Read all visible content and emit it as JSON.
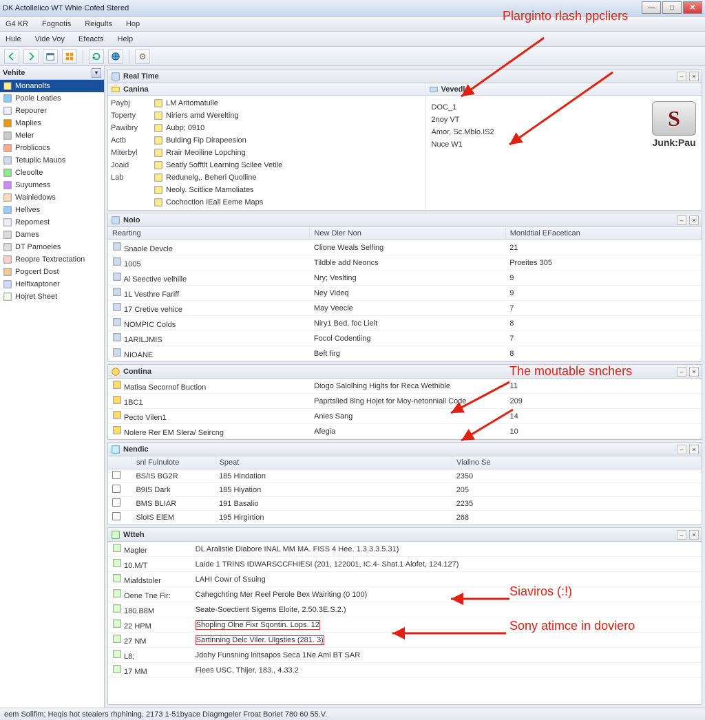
{
  "window": {
    "title": "DK Actollelico WT Whie Cofed Stered"
  },
  "menus_top": [
    "G4 KR",
    "Fognotis",
    "Reigults",
    "Hop"
  ],
  "menus": [
    "Hule",
    "Vide Voy",
    "Efeacts",
    "Help"
  ],
  "sidebar": {
    "header": "Vehite",
    "items": [
      {
        "label": "Monanolts",
        "sel": true,
        "icon": "folder"
      },
      {
        "label": "Poole Leaties",
        "icon": "globe"
      },
      {
        "label": "Repourer",
        "icon": "doc"
      },
      {
        "label": "Maplies",
        "icon": "grid"
      },
      {
        "label": "Meler",
        "icon": "meter"
      },
      {
        "label": "Problicocs",
        "icon": "wrench"
      },
      {
        "label": "Tetuplic Mauos",
        "icon": "phone"
      },
      {
        "label": "Cleoolte",
        "icon": "check"
      },
      {
        "label": "Suyumess",
        "icon": "chart"
      },
      {
        "label": "Wainledows",
        "icon": "cards"
      },
      {
        "label": "Hellves",
        "icon": "help"
      },
      {
        "label": "Repomest",
        "icon": "doc"
      },
      {
        "label": "Dames",
        "icon": "disk"
      },
      {
        "label": "DT Pamoeies",
        "icon": "disk"
      },
      {
        "label": "Reopre Textrectation",
        "icon": "gear"
      },
      {
        "label": "Pogcert Dost",
        "icon": "box"
      },
      {
        "label": "Helfixaptoner",
        "icon": "wand"
      },
      {
        "label": "Hojret Sheet",
        "icon": "sheet"
      }
    ]
  },
  "realtime": {
    "title": "Real Time"
  },
  "canina": {
    "title": "Canina",
    "rows": [
      {
        "k": "Paybj",
        "v": "LM Aritomatulle"
      },
      {
        "k": "Toperty",
        "v": "Niriers amd Werelting"
      },
      {
        "k": "Pawibry",
        "v": "Aubp; 0910"
      },
      {
        "k": "Actb",
        "v": "Bulding Fip Dirapeesion"
      },
      {
        "k": "Miterbyl",
        "v": "Rrair Meoiline Lopching"
      },
      {
        "k": "Joaid",
        "v": "Seatly 5offtlt Learning Scilee Vetile"
      },
      {
        "k": "Lab",
        "v": "Redunelg,. Beheri Quolline"
      },
      {
        "k": "",
        "v": "Neoly. Scitlice Mamoliates"
      },
      {
        "k": "",
        "v": "Cochoction IEall Eeme Maps"
      }
    ]
  },
  "vehicle": {
    "title": "Vevedle",
    "items": [
      "DOC_1",
      "2noy VT",
      "Amor, Sc.Mblo.IS2",
      "Nuce W1"
    ],
    "brand": "Junk:Pau"
  },
  "nolo": {
    "title": "Nolo",
    "cols": [
      "Rearting",
      "New Dier Non",
      "Monldtial EFacetican"
    ],
    "rows": [
      [
        "Snaole Devcle",
        "Clione Weals Selfing",
        "21"
      ],
      [
        "1005",
        "Tildble add Neoncs",
        "Proeites 305"
      ],
      [
        "Al Seective velhille",
        "Nry; Veslting",
        "9"
      ],
      [
        "1L Vesthre Fariff",
        "Ney Videq",
        "9"
      ],
      [
        "17 Cretive vehice",
        "May Veecle",
        "7"
      ],
      [
        "NOMPIC Colds",
        "Niry1 Bed, foc Lieit",
        "8"
      ],
      [
        "1ARILJMIS",
        "Focol Codentiing",
        "7"
      ],
      [
        "NIOANE",
        "Beft firg",
        "8"
      ]
    ]
  },
  "contina": {
    "title": "Contina",
    "rows": [
      [
        "Matisa Secornof Buction",
        "Diogo Salolhing Higlts for Reca Wethible",
        "11"
      ],
      [
        "1BC1",
        "Paprtslied 8lng Hojet for Moy-netonniall Code",
        "209"
      ],
      [
        "Pecto Vilen1",
        "Anies Sang",
        "14"
      ],
      [
        "Nolere Rer EM Slera/ Seircng",
        "Afegia",
        "10"
      ]
    ]
  },
  "nendic": {
    "title": "Nendic",
    "cols": [
      "snl Fulnulote",
      "Speat",
      "",
      "Vialino Se"
    ],
    "rows": [
      [
        "BS/IS BG2R",
        "185 Hindation",
        "",
        "2350"
      ],
      [
        "B9IS Dark",
        "185 Hiyation",
        "",
        "205"
      ],
      [
        "BMS BLIAR",
        "191 Basalio",
        "",
        "2235"
      ],
      [
        "SloIS ElEM",
        "195 Hirgirtion",
        "",
        "268"
      ]
    ]
  },
  "witeh": {
    "title": "Wtteh",
    "rows": [
      [
        "Magler",
        "DL Aralistie Diabore INAL MM MA. FISS 4 Hee. 1.3.3.3.5.31)"
      ],
      [
        "10.M/T",
        "Laide 1 TRINS IDWARSCCFHIESI (201, 122001, IC.4- Shat.1 Alofet, 124.127)"
      ],
      [
        "Miafdstoler",
        "LAHI Cowr of Ssuing"
      ],
      [
        "Oene Tne Fir:",
        "Cahegchting          Mer Reel Perole Bex Wairiting (0 100)"
      ],
      [
        "180.B8M",
        "Seate-Soectient          Sigems Eloite, 2.50.3E.S.2.)"
      ],
      [
        "22 HPM",
        "Shopling          Olne Fixr Sqontin. Lops. 12"
      ],
      [
        "27 NM",
        "Sartinning          Delc Viler. Ulgsties (281. 3)"
      ],
      [
        "L8;",
        "Jdohy Funsning lnitsapos     Seca 1Ne Aml BT SAR"
      ],
      [
        "17 MM",
        "Fiees          USC, Thijer, 183., 4.33.2"
      ]
    ]
  },
  "status": "eem Solifim; Heqis hot steaiers rhphining, 2173 1-51byace Diagmgeler Froat Boriet 780 60 55.V.",
  "annotations": {
    "a1": "Plarginto rlash ppcliers",
    "a2": "The moutable snchers",
    "a3": "Siaviros (:!)",
    "a4": "Sony atimce in doviero"
  }
}
